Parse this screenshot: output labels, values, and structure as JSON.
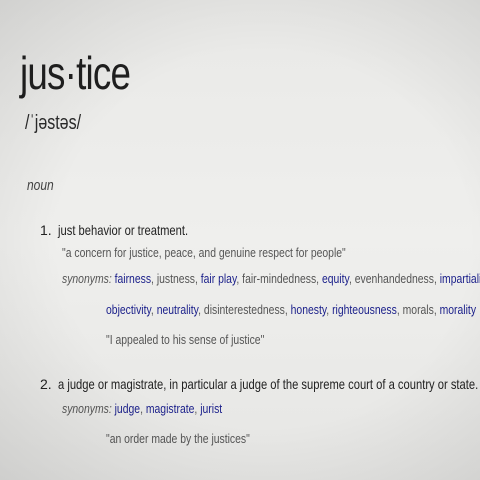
{
  "entry": {
    "word": "jus·tice",
    "phonetic": "/ˈjəstəs/",
    "part_of_speech": "noun"
  },
  "senses": [
    {
      "number": "1.",
      "definition": "just behavior or treatment.",
      "example": "\"a concern for justice, peace, and genuine respect for people\"",
      "synonyms_label": "synonyms:",
      "synonyms_line1": [
        {
          "text": "fairness",
          "link": true
        },
        {
          "text": ", justness, ",
          "link": false
        },
        {
          "text": "fair play",
          "link": true
        },
        {
          "text": ", fair-mindedness, ",
          "link": false
        },
        {
          "text": "equity",
          "link": true
        },
        {
          "text": ", evenhandedness, ",
          "link": false
        },
        {
          "text": "impartiality",
          "link": true
        },
        {
          "text": ",",
          "link": false
        }
      ],
      "synonyms_line2": [
        {
          "text": "objectivity",
          "link": true
        },
        {
          "text": ", ",
          "link": false
        },
        {
          "text": "neutrality",
          "link": true
        },
        {
          "text": ", disinterestedness, ",
          "link": false
        },
        {
          "text": "honesty",
          "link": true
        },
        {
          "text": ", ",
          "link": false
        },
        {
          "text": "righteousness",
          "link": true
        },
        {
          "text": ", morals, ",
          "link": false
        },
        {
          "text": "morality",
          "link": true
        }
      ],
      "example2": "\"I appealed to his sense of justice\""
    },
    {
      "number": "2.",
      "definition": "a judge or magistrate, in particular a judge of the supreme court of a country or state.",
      "synonyms_label": "synonyms:",
      "synonyms_line1": [
        {
          "text": "judge",
          "link": true
        },
        {
          "text": ", ",
          "link": false
        },
        {
          "text": "magistrate",
          "link": true
        },
        {
          "text": ", ",
          "link": false
        },
        {
          "text": "jurist",
          "link": true
        }
      ],
      "example": "\"an order made by the justices\""
    }
  ],
  "colors": {
    "link": "#1a1f8a",
    "text": "#222222",
    "muted": "#555555",
    "background": "#ededeb"
  }
}
